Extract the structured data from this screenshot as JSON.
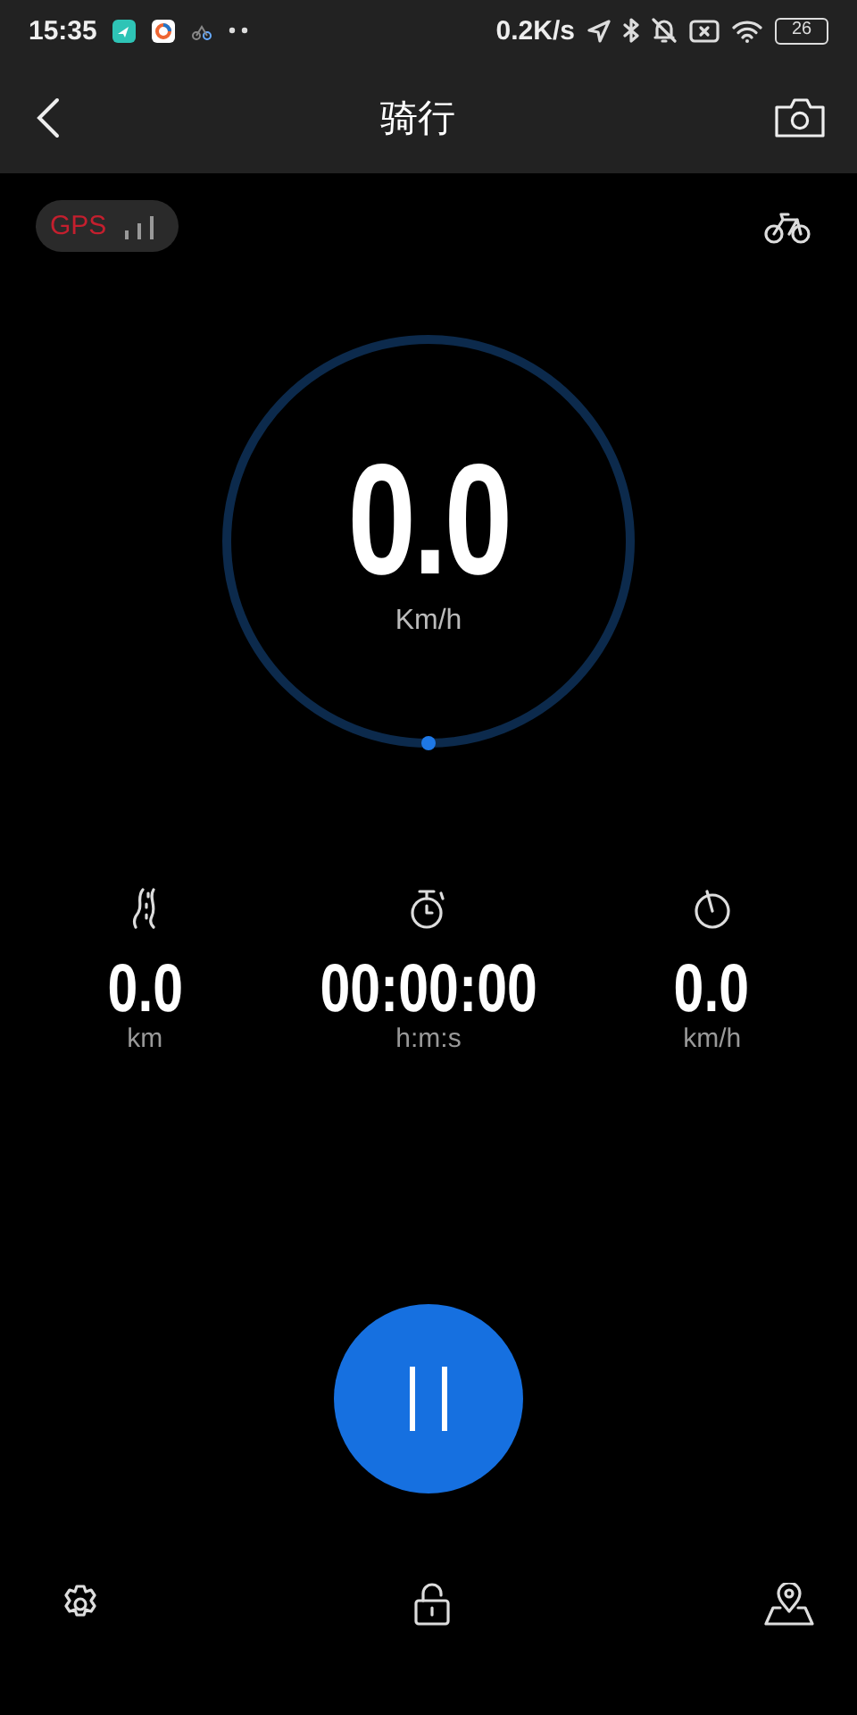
{
  "status_bar": {
    "time": "15:35",
    "network_speed": "0.2K/s",
    "battery": "26"
  },
  "header": {
    "title": "骑行"
  },
  "gps": {
    "label": "GPS"
  },
  "speed": {
    "value": "0.0",
    "unit": "Km/h"
  },
  "stats": [
    {
      "kind": "distance",
      "value": "0.0",
      "unit": "km"
    },
    {
      "kind": "duration",
      "value": "00:00:00",
      "unit": "h:m:s"
    },
    {
      "kind": "speed",
      "value": "0.0",
      "unit": "km/h"
    }
  ]
}
